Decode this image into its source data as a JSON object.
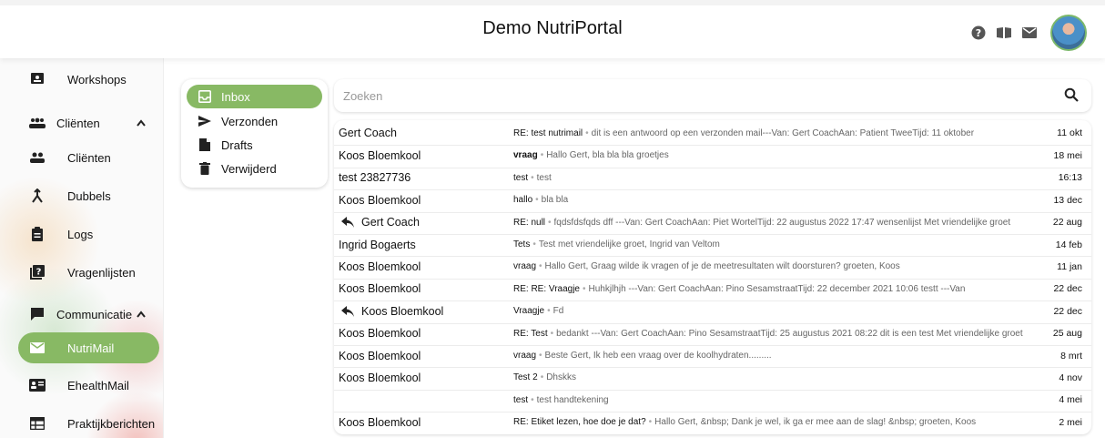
{
  "header": {
    "title": "Demo NutriPortal",
    "icons": [
      "help-icon",
      "book-icon",
      "mail-icon"
    ]
  },
  "sidebar": {
    "workshops": "Workshops",
    "clienten_group": "Cliënten",
    "clienten": "Cliënten",
    "dubbels": "Dubbels",
    "logs": "Logs",
    "vragenlijsten": "Vragenlijsten",
    "communicatie_group": "Communicatie",
    "nutrimail": "NutriMail",
    "ehealthmail": "EhealthMail",
    "praktijkberichten": "Praktijkberichten"
  },
  "folders": {
    "inbox": "Inbox",
    "sent": "Verzonden",
    "drafts": "Drafts",
    "deleted": "Verwijderd"
  },
  "search": {
    "placeholder": "Zoeken"
  },
  "accent": "#88b964",
  "messages": [
    {
      "sender": "Gert Coach",
      "reply": false,
      "subject": "RE: test nutrimail",
      "bold": false,
      "preview": "dit is een antwoord op een verzonden mail---Van: Gert CoachAan: Patient TweeTijd: 11 oktober",
      "date": "11 okt"
    },
    {
      "sender": "Koos Bloemkool",
      "reply": false,
      "subject": "vraag",
      "bold": true,
      "preview": "Hallo Gert,  bla bla bla  groetjes",
      "date": "18 mei"
    },
    {
      "sender": "test 23827736",
      "reply": false,
      "subject": "test",
      "bold": false,
      "preview": "test",
      "date": "16:13"
    },
    {
      "sender": "Koos Bloemkool",
      "reply": false,
      "subject": "hallo",
      "bold": false,
      "preview": "bla bla",
      "date": "13 dec"
    },
    {
      "sender": "Gert Coach",
      "reply": true,
      "subject": "RE: null",
      "bold": false,
      "preview": "fqdsfdsfqds dff ---Van: Gert CoachAan: Piet WortelTijd: 22 augustus 2022 17:47 wensenlijst  Met vriendelijke groet",
      "date": "22 aug"
    },
    {
      "sender": "Ingrid Bogaerts",
      "reply": false,
      "subject": "Tets",
      "bold": false,
      "preview": "Test met vriendelijke groet, Ingrid van Veltom",
      "date": "14 feb"
    },
    {
      "sender": "Koos Bloemkool",
      "reply": false,
      "subject": "vraag",
      "bold": false,
      "preview": "Hallo Gert, Graag wilde ik vragen of je de meetresultaten wilt doorsturen? groeten, Koos",
      "date": "11 jan"
    },
    {
      "sender": "Koos Bloemkool",
      "reply": false,
      "subject": "RE: RE: Vraagje",
      "bold": false,
      "preview": "Huhkjlhjh ---Van: Gert CoachAan: Pino SesamstraatTijd: 22 december 2021 10:06 testt ---Van",
      "date": "22 dec"
    },
    {
      "sender": "Koos Bloemkool",
      "reply": true,
      "subject": "Vraagje",
      "bold": false,
      "preview": "Fd",
      "date": "22 dec"
    },
    {
      "sender": "Koos Bloemkool",
      "reply": false,
      "subject": "RE: Test",
      "bold": false,
      "preview": "bedankt ---Van: Gert CoachAan: Pino SesamstraatTijd: 25 augustus 2021 08:22 dit is een test Met vriendelijke groet",
      "date": "25 aug"
    },
    {
      "sender": "Koos Bloemkool",
      "reply": false,
      "subject": "vraag",
      "bold": false,
      "preview": "Beste Gert, Ik heb een vraag over de koolhydraten.........",
      "date": "8 mrt"
    },
    {
      "sender": "Koos Bloemkool",
      "reply": false,
      "subject": "Test 2",
      "bold": false,
      "preview": "Dhskks",
      "date": "4 nov"
    },
    {
      "sender": "",
      "reply": false,
      "subject": "test",
      "bold": false,
      "preview": "test handtekening",
      "date": "4 mei"
    },
    {
      "sender": "Koos Bloemkool",
      "reply": false,
      "subject": "RE: Etiket lezen, hoe doe je dat?",
      "bold": false,
      "preview": "Hallo Gert, &nbsp; Dank je wel, ik ga er mee aan de slag! &nbsp; groeten, Koos",
      "date": "2 mei"
    }
  ]
}
